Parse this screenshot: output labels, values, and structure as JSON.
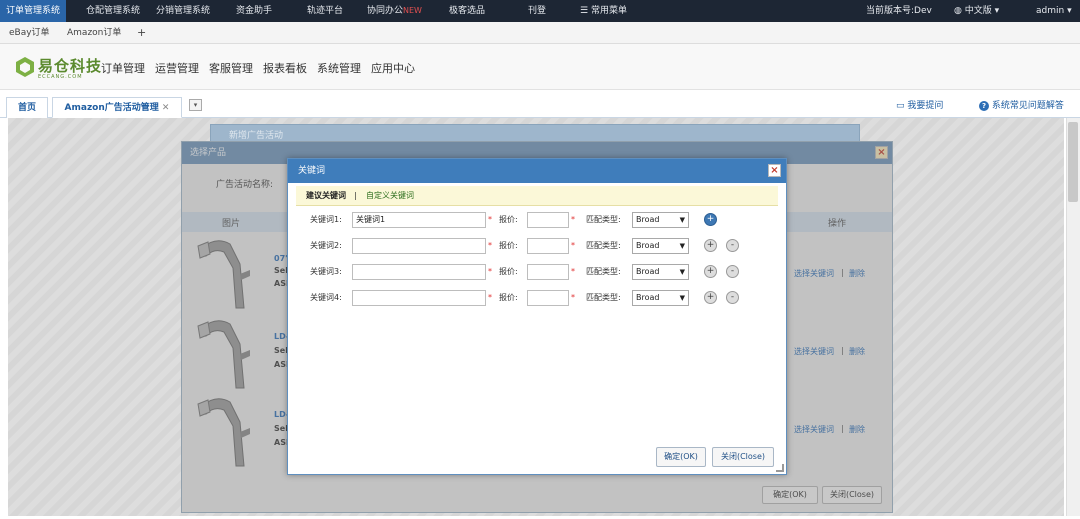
{
  "topnav": {
    "items": [
      "订单管理系统",
      "仓配管理系统",
      "分销管理系统",
      "资金助手",
      "轨迹平台",
      "协同办公",
      "极客选品",
      "刊登",
      "常用菜单"
    ],
    "hot_badge": "NEW",
    "version": "当前版本号:Dev",
    "language": "中文版",
    "user": "admin"
  },
  "account_tabs": [
    "eBay订单",
    "Amazon订单",
    "+"
  ],
  "logo": {
    "name": "易仓科技",
    "sub": "ECCANG.COM"
  },
  "main_menu": [
    "订单管理",
    "运营管理",
    "客服管理",
    "报表看板",
    "系统管理",
    "应用中心"
  ],
  "page_tabs": {
    "home": "首页",
    "active": "Amazon广告活动管理"
  },
  "help": {
    "ask": "我要提问",
    "faq": "系统常见问题解答"
  },
  "bg_dialog": {
    "back_title": "新增广告活动",
    "title": "选择产品",
    "campaign_label": "广告活动名称:",
    "col_image": "图片",
    "col_action": "操作",
    "products": [
      {
        "code": "07'1",
        "line2": "Sel",
        "line3": "ASI"
      },
      {
        "code": "LD-",
        "line2": "Sel",
        "line3": "ASI"
      },
      {
        "code": "LD-",
        "line2": "Sel",
        "line3": "ASI"
      }
    ],
    "select_kw": "选择关键词",
    "divider": "|",
    "delete": "删除",
    "ok": "确定(OK)",
    "close": "关闭(Close)"
  },
  "dialog": {
    "title": "关键词",
    "close_x": "×",
    "tab_suggest": "建议关键词",
    "tab_custom": "自定义关键词",
    "rows": [
      {
        "label": "关键词1:",
        "value": "关键词1",
        "bid_label": "报价:",
        "match_label": "匹配类型:",
        "match": "Broad"
      },
      {
        "label": "关键词2:",
        "value": "",
        "bid_label": "报价:",
        "match_label": "匹配类型:",
        "match": "Broad"
      },
      {
        "label": "关键词3:",
        "value": "",
        "bid_label": "报价:",
        "match_label": "匹配类型:",
        "match": "Broad"
      },
      {
        "label": "关键词4:",
        "value": "",
        "bid_label": "报价:",
        "match_label": "匹配类型:",
        "match": "Broad"
      }
    ],
    "required_mark": "*",
    "plus": "+",
    "minus": "-",
    "ok": "确定(OK)",
    "close": "关闭(Close)"
  },
  "colors": {
    "topnav": "#1d2634",
    "dialog_header": "#3f7dbb",
    "accent": "#2a65a8"
  }
}
